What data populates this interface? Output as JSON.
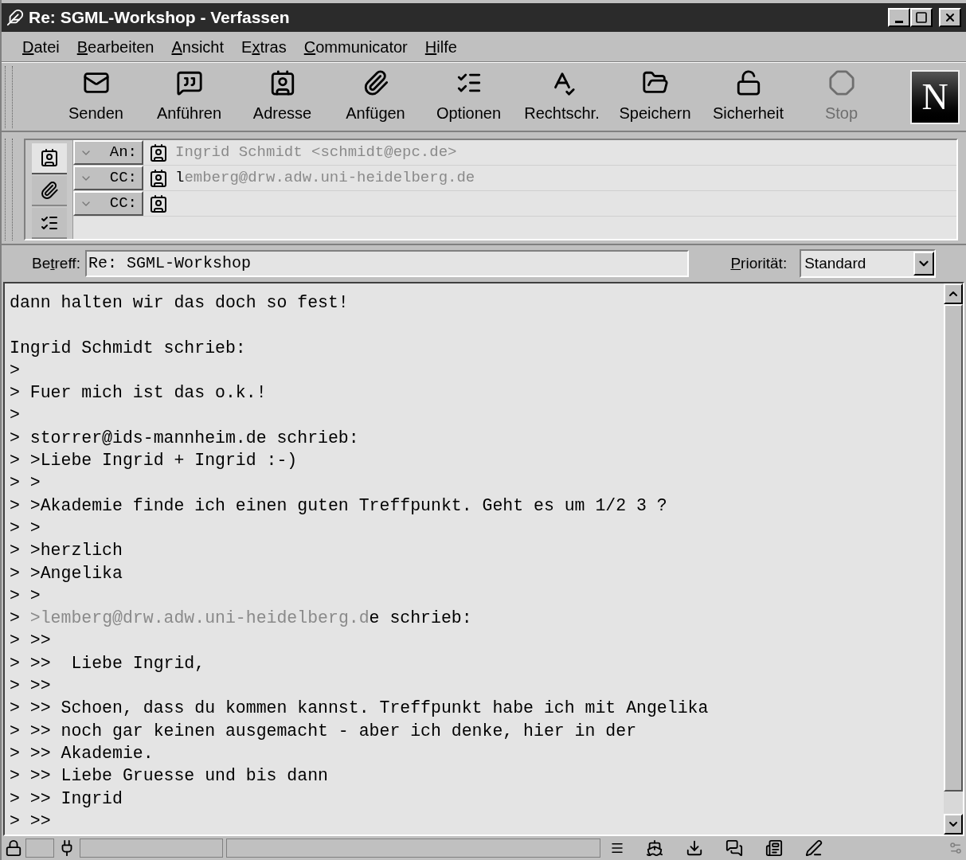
{
  "window": {
    "title": "Re: SGML-Workshop - Verfassen"
  },
  "menu": [
    {
      "key": "D",
      "rest": "atei"
    },
    {
      "key": "B",
      "rest": "earbeiten"
    },
    {
      "key": "A",
      "rest": "nsicht"
    },
    {
      "before": "E",
      "key": "x",
      "rest": "tras"
    },
    {
      "key": "C",
      "rest": "ommunicator"
    },
    {
      "key": "H",
      "rest": "ilfe"
    }
  ],
  "toolbar": [
    {
      "kind": "send",
      "label": "Senden",
      "disabled": false
    },
    {
      "kind": "quote",
      "label": "Anführen",
      "disabled": false
    },
    {
      "kind": "address",
      "label": "Adresse",
      "disabled": false
    },
    {
      "kind": "attach",
      "label": "Anfügen",
      "disabled": false
    },
    {
      "kind": "options",
      "label": "Optionen",
      "disabled": false
    },
    {
      "kind": "spell",
      "label": "Rechtschr.",
      "disabled": false
    },
    {
      "kind": "save",
      "label": "Speichern",
      "disabled": false
    },
    {
      "kind": "security",
      "label": "Sicherheit",
      "disabled": false
    },
    {
      "kind": "stop",
      "label": "Stop",
      "disabled": true
    }
  ],
  "logo": "N",
  "address_tabs": [
    {
      "kind": "address",
      "selected": true
    },
    {
      "kind": "attach",
      "selected": false
    },
    {
      "kind": "options",
      "selected": false
    }
  ],
  "recipients": [
    {
      "type": "An:",
      "segments": [
        {
          "text": "Ingrid Schmidt <schmidt@epc.de>",
          "faded": true
        }
      ]
    },
    {
      "type": "CC:",
      "segments": [
        {
          "text": "l",
          "faded": false
        },
        {
          "text": "emberg@drw.adw.uni-heidelberg.de",
          "faded": true
        }
      ]
    },
    {
      "type": "CC:"
    }
  ],
  "subject": {
    "label": {
      "before": "Be",
      "key": "t",
      "rest": "reff:"
    },
    "value": "Re: SGML-Workshop"
  },
  "priority": {
    "label": {
      "key": "P",
      "rest": "riorität:"
    },
    "value": "Standard"
  },
  "body": [
    {
      "kind": "text",
      "segments": [
        {
          "text": "dann halten wir das doch so fest!",
          "faded": false
        }
      ]
    },
    {
      "kind": "blank"
    },
    {
      "kind": "text",
      "segments": [
        {
          "text": "Ingrid Schmidt schrieb:",
          "faded": false
        }
      ]
    },
    {
      "kind": "text",
      "segments": [
        {
          "text": ">",
          "faded": false
        }
      ]
    },
    {
      "kind": "text",
      "segments": [
        {
          "text": "> Fuer mich ist das o.k.!",
          "faded": false
        }
      ]
    },
    {
      "kind": "text",
      "segments": [
        {
          "text": ">",
          "faded": false
        }
      ]
    },
    {
      "kind": "text",
      "segments": [
        {
          "text": "> storrer@ids-mannheim.de schrieb:",
          "faded": false
        }
      ]
    },
    {
      "kind": "text",
      "segments": [
        {
          "text": "> >Liebe Ingrid + Ingrid :-)",
          "faded": false
        }
      ]
    },
    {
      "kind": "text",
      "segments": [
        {
          "text": "> >",
          "faded": false
        }
      ]
    },
    {
      "kind": "text",
      "segments": [
        {
          "text": "> >Akademie finde ich einen guten Treffpunkt. Geht es um 1/2 3 ?",
          "faded": false
        }
      ]
    },
    {
      "kind": "text",
      "segments": [
        {
          "text": "> >",
          "faded": false
        }
      ]
    },
    {
      "kind": "text",
      "segments": [
        {
          "text": "> >herzlich",
          "faded": false
        }
      ]
    },
    {
      "kind": "text",
      "segments": [
        {
          "text": "> >Angelika",
          "faded": false
        }
      ]
    },
    {
      "kind": "text",
      "segments": [
        {
          "text": "> >",
          "faded": false
        }
      ]
    },
    {
      "kind": "text",
      "segments": [
        {
          "text": "> ",
          "faded": false
        },
        {
          "text": ">lemberg@drw.adw.uni-heidelberg.d",
          "faded": true
        },
        {
          "text": "e schrieb:",
          "faded": false
        }
      ]
    },
    {
      "kind": "text",
      "segments": [
        {
          "text": "> >>",
          "faded": false
        }
      ]
    },
    {
      "kind": "text",
      "segments": [
        {
          "text": "> >>  Liebe Ingrid,",
          "faded": false
        }
      ]
    },
    {
      "kind": "text",
      "segments": [
        {
          "text": "> >>",
          "faded": false
        }
      ]
    },
    {
      "kind": "text",
      "segments": [
        {
          "text": "> >> Schoen, dass du kommen kannst. Treffpunkt habe ich mit Angelika",
          "faded": false
        }
      ]
    },
    {
      "kind": "text",
      "segments": [
        {
          "text": "> >> noch gar keinen ausgemacht - aber ich denke, hier in der",
          "faded": false
        }
      ]
    },
    {
      "kind": "text",
      "segments": [
        {
          "text": "> >> Akademie.",
          "faded": false
        }
      ]
    },
    {
      "kind": "text",
      "segments": [
        {
          "text": "> >> Liebe Gruesse und bis dann",
          "faded": false
        }
      ]
    },
    {
      "kind": "text",
      "segments": [
        {
          "text": "> >> Ingrid",
          "faded": false
        }
      ]
    },
    {
      "kind": "text",
      "segments": [
        {
          "text": "> >>",
          "faded": false
        }
      ]
    }
  ]
}
